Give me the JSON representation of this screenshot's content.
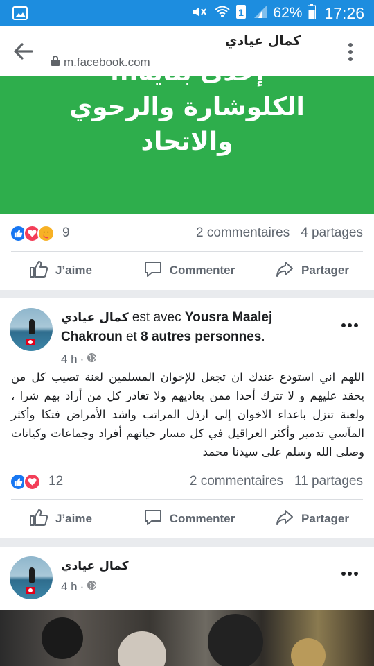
{
  "status_bar": {
    "battery": "62%",
    "time": "17:26"
  },
  "browser": {
    "title": "كمال عيادي",
    "url": "m.facebook.com"
  },
  "banner": {
    "line1": "إحدى بناية...",
    "line2": "الكلوشارة والرحوي",
    "line3": "والاتحاد"
  },
  "post1": {
    "reaction_count": "9",
    "comments": "2 commentaires",
    "shares": "4 partages"
  },
  "actions": {
    "like": "J’aime",
    "comment": "Commenter",
    "share": "Partager"
  },
  "post2": {
    "author": "كمال عيادي",
    "with_text": "est avec",
    "tagged": "Yousra Maalej Chakroun",
    "and_text": "et",
    "others": "8 autres personnes",
    "time": "4 h",
    "body": "اللهم اني استودع عندك ان تجعل للإخوان المسلمين لعنة تصيب كل من يحقد عليهم و لا تترك أحدا ممن يعاديهم ولا تغادر كل من أراد بهم شرا ، ولعنة تنزل باعداء الاخوان إلى ارذل المراتب واشد الأمراض فتكا وأكثر المآسي تدمير وأكثر العراقيل في كل مسار حياتهم أفراد وجماعات وكيانات وصلى الله وسلم على سيدنا محمد",
    "reaction_count": "12",
    "comments": "2 commentaires",
    "shares": "11 partages"
  },
  "post3": {
    "author": "كمال عيادي",
    "time": "4 h"
  },
  "colors": {
    "fb_blue": "#1877f2",
    "status_blue": "#1d8ddf",
    "banner_green": "#2eae4c"
  }
}
